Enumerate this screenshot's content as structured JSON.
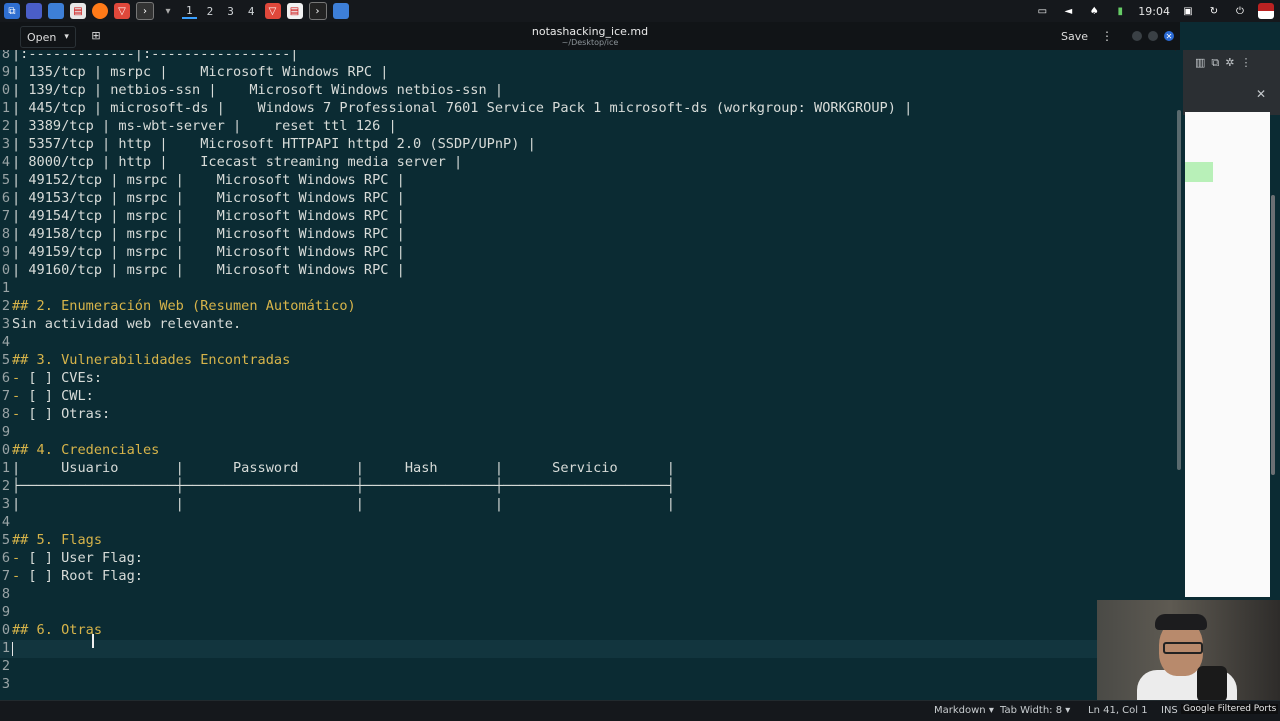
{
  "topbar": {
    "workspaces": [
      "1",
      "2",
      "3",
      "4"
    ],
    "clock": "19:04"
  },
  "header": {
    "open_label": "Open",
    "title": "notashacking_ice.md",
    "subtitle": "~/Desktop/ice",
    "save_label": "Save"
  },
  "editor": {
    "lines": [
      {
        "n": "8",
        "t": "|:-------------|:-----------------|"
      },
      {
        "n": "9",
        "t": "| 135/tcp | msrpc |    Microsoft Windows RPC |"
      },
      {
        "n": "0",
        "t": "| 139/tcp | netbios-ssn |    Microsoft Windows netbios-ssn |"
      },
      {
        "n": "1",
        "t": "| 445/tcp | microsoft-ds |    Windows 7 Professional 7601 Service Pack 1 microsoft-ds (workgroup: WORKGROUP) |"
      },
      {
        "n": "2",
        "t": "| 3389/tcp | ms-wbt-server |    reset ttl 126 |"
      },
      {
        "n": "3",
        "t": "| 5357/tcp | http |    Microsoft HTTPAPI httpd 2.0 (SSDP/UPnP) |"
      },
      {
        "n": "4",
        "t": "| 8000/tcp | http |    Icecast streaming media server |"
      },
      {
        "n": "5",
        "t": "| 49152/tcp | msrpc |    Microsoft Windows RPC |"
      },
      {
        "n": "6",
        "t": "| 49153/tcp | msrpc |    Microsoft Windows RPC |"
      },
      {
        "n": "7",
        "t": "| 49154/tcp | msrpc |    Microsoft Windows RPC |"
      },
      {
        "n": "8",
        "t": "| 49158/tcp | msrpc |    Microsoft Windows RPC |"
      },
      {
        "n": "9",
        "t": "| 49159/tcp | msrpc |    Microsoft Windows RPC |"
      },
      {
        "n": "0",
        "t": "| 49160/tcp | msrpc |    Microsoft Windows RPC |"
      },
      {
        "n": "1",
        "t": ""
      },
      {
        "n": "2",
        "t": "## 2. Enumeración Web (Resumen Automático)",
        "h": true
      },
      {
        "n": "3",
        "t": "Sin actividad web relevante."
      },
      {
        "n": "4",
        "t": ""
      },
      {
        "n": "5",
        "t": "## 3. Vulnerabilidades Encontradas",
        "h": true
      },
      {
        "n": "6",
        "t": "- [ ] CVEs:",
        "d": true
      },
      {
        "n": "7",
        "t": "- [ ] CWL:",
        "d": true
      },
      {
        "n": "8",
        "t": "- [ ] Otras:",
        "d": true
      },
      {
        "n": "9",
        "t": ""
      },
      {
        "n": "0",
        "t": "## 4. Credenciales",
        "h": true
      },
      {
        "n": "1",
        "t": "|     Usuario       |      Password       |     Hash       |      Servicio      |"
      },
      {
        "n": "2",
        "t": "├───────────────────┼─────────────────────┼────────────────┼────────────────────┤"
      },
      {
        "n": "3",
        "t": "|                   |                     |                |                    |"
      },
      {
        "n": "4",
        "t": ""
      },
      {
        "n": "5",
        "t": "## 5. Flags",
        "h": true
      },
      {
        "n": "6",
        "t": "- [ ] User Flag:",
        "d": true
      },
      {
        "n": "7",
        "t": "- [ ] Root Flag:",
        "d": true
      },
      {
        "n": "8",
        "t": ""
      },
      {
        "n": "9",
        "t": ""
      },
      {
        "n": "0",
        "t": "## 6. Otras",
        "h": true
      },
      {
        "n": "1",
        "t": ""
      },
      {
        "n": "2",
        "t": ""
      },
      {
        "n": "3",
        "t": ""
      }
    ]
  },
  "statusbar": {
    "language": "Markdown",
    "tab_width": "Tab Width: 8",
    "position": "Ln 41, Col 1",
    "mode": "INS",
    "extension": "Google Filtered Ports"
  }
}
